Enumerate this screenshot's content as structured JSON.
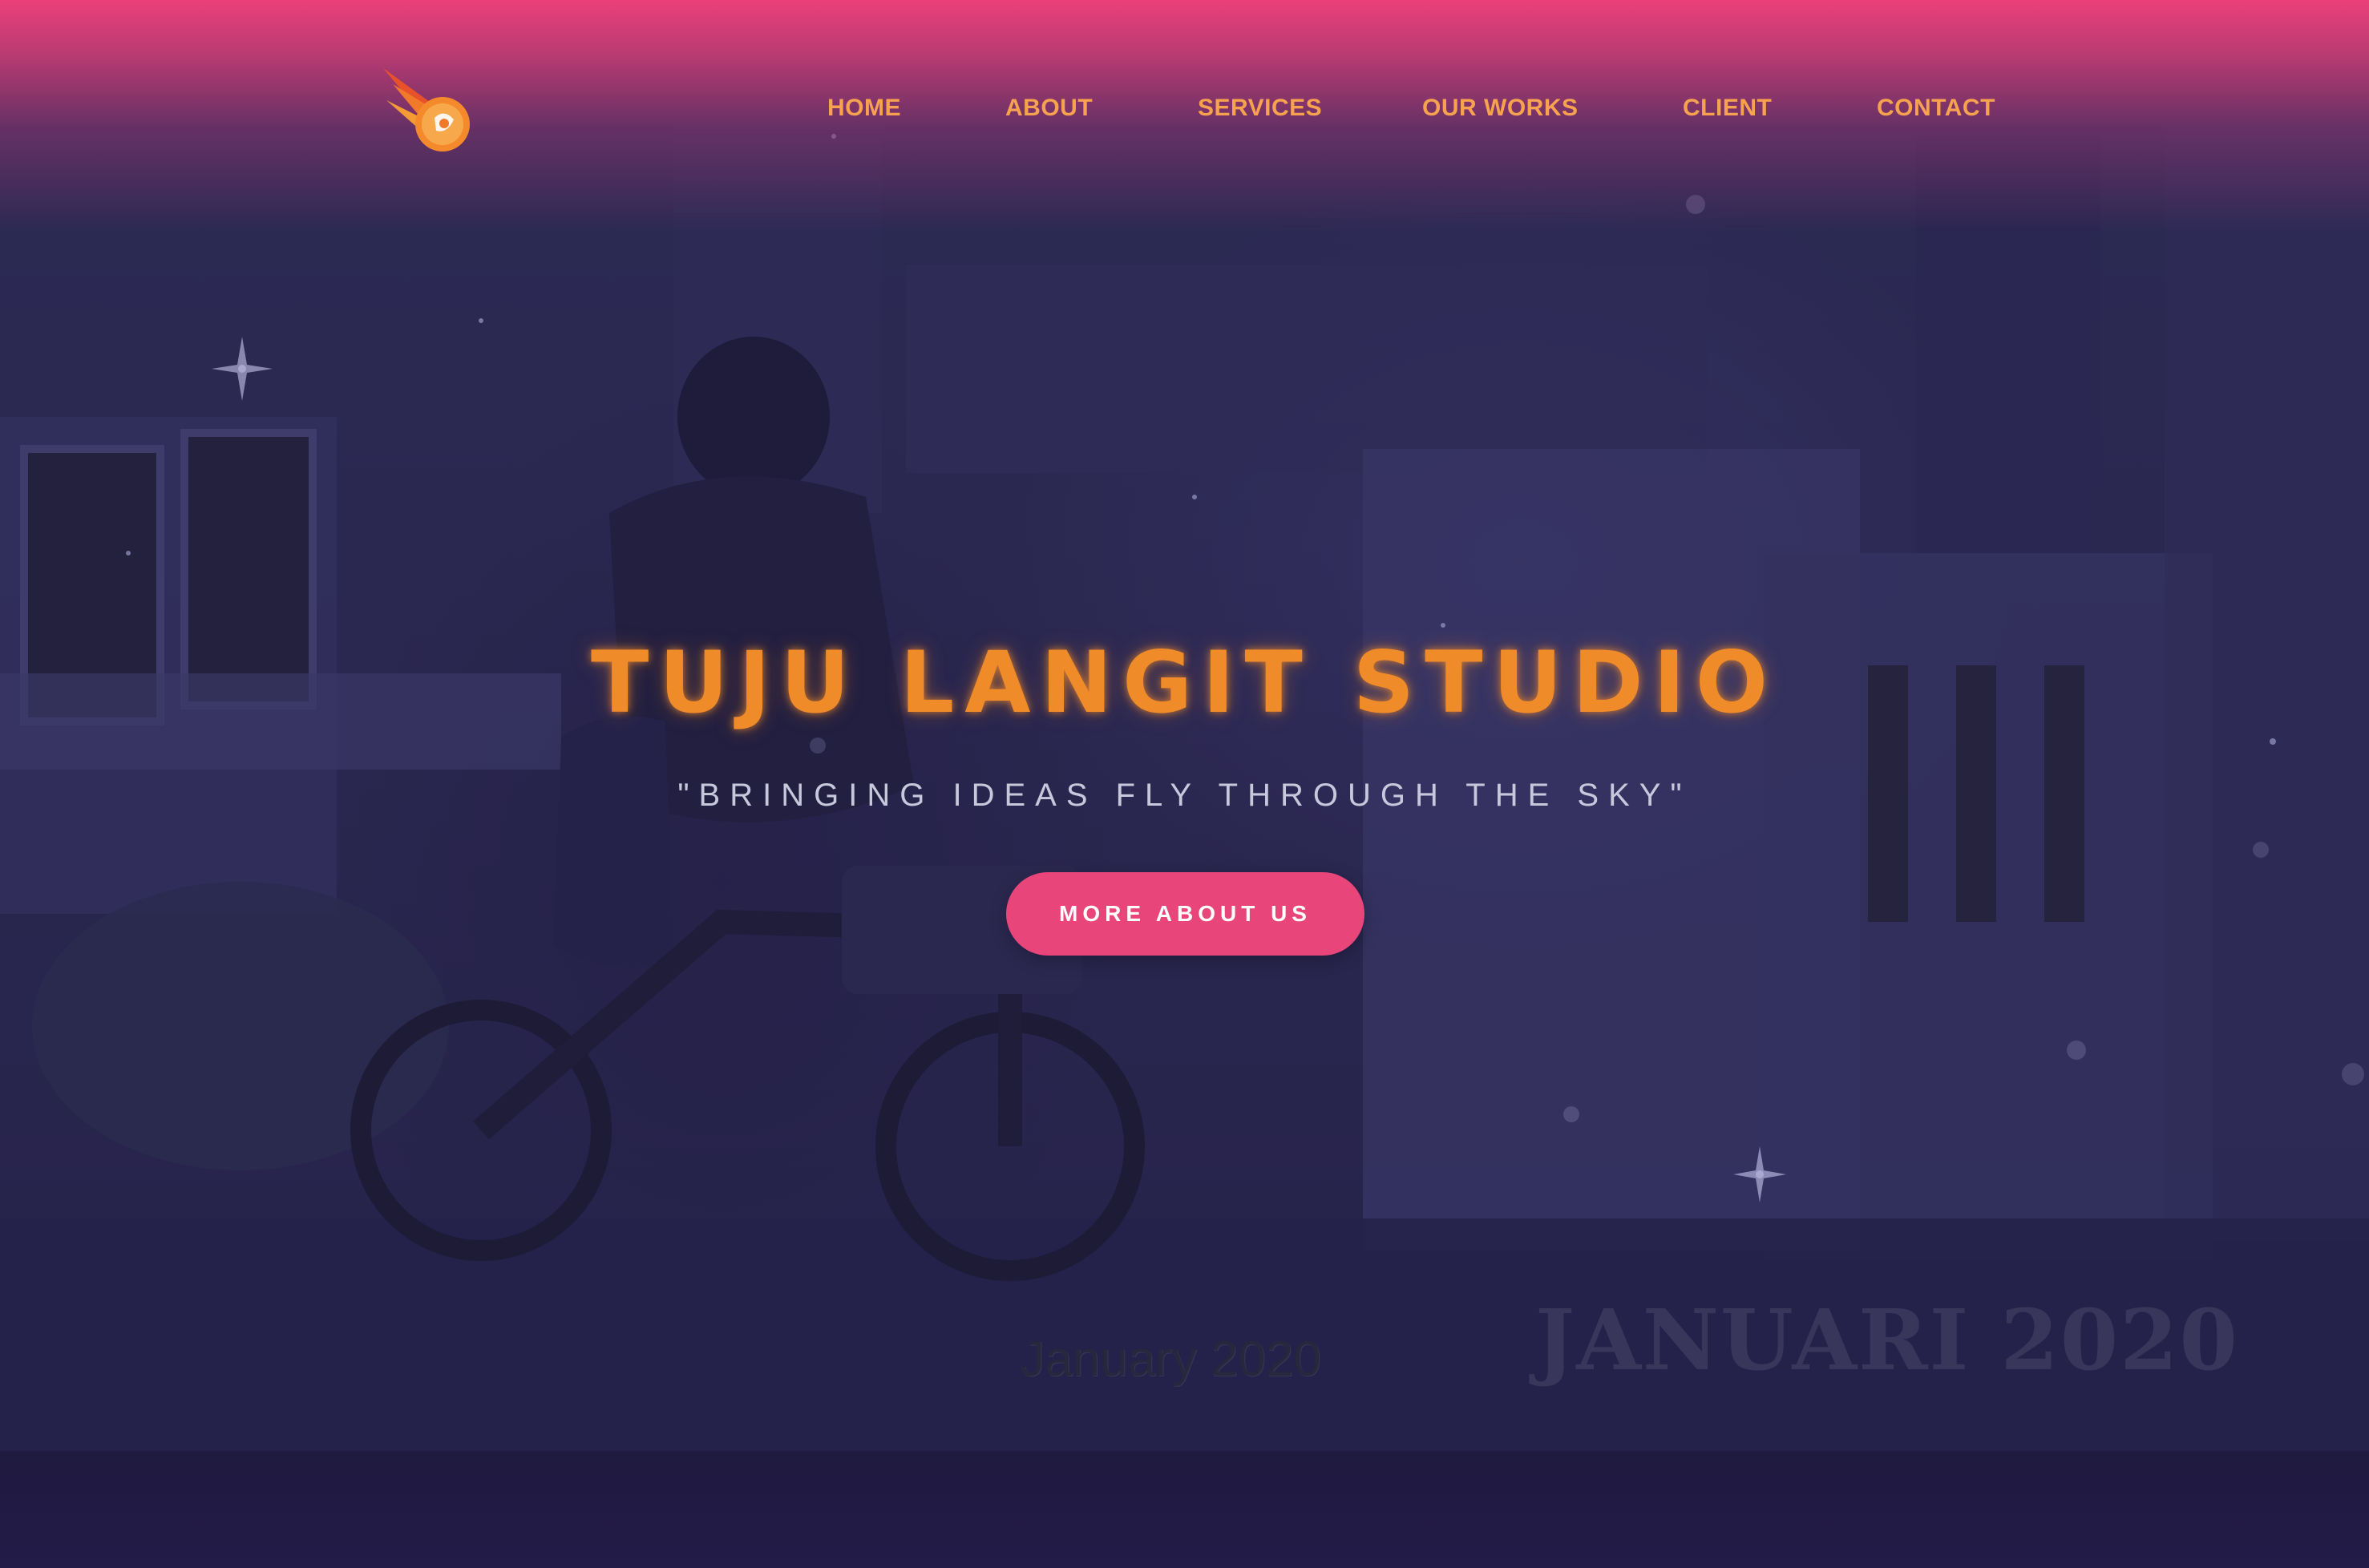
{
  "brand": {
    "logo_icon": "flaming-orange-comet-logo"
  },
  "nav": {
    "items": [
      {
        "label": "HOME"
      },
      {
        "label": "ABOUT"
      },
      {
        "label": "SERVICES"
      },
      {
        "label": "OUR WORKS"
      },
      {
        "label": "CLIENT"
      },
      {
        "label": "CONTACT"
      }
    ]
  },
  "hero": {
    "title": "TUJU LANGIT STUDIO",
    "tagline": "\"BRINGING IDEAS FLY THROUGH THE SKY\"",
    "cta_label": "MORE ABOUT US",
    "photo_date_small": "January 2020",
    "photo_date_large": "JANUARI 2020"
  },
  "colors": {
    "accent_pink": "#e8467a",
    "nav_orange": "#f6a24f",
    "title_orange": "#f08b2a",
    "background": "#2a2750"
  }
}
